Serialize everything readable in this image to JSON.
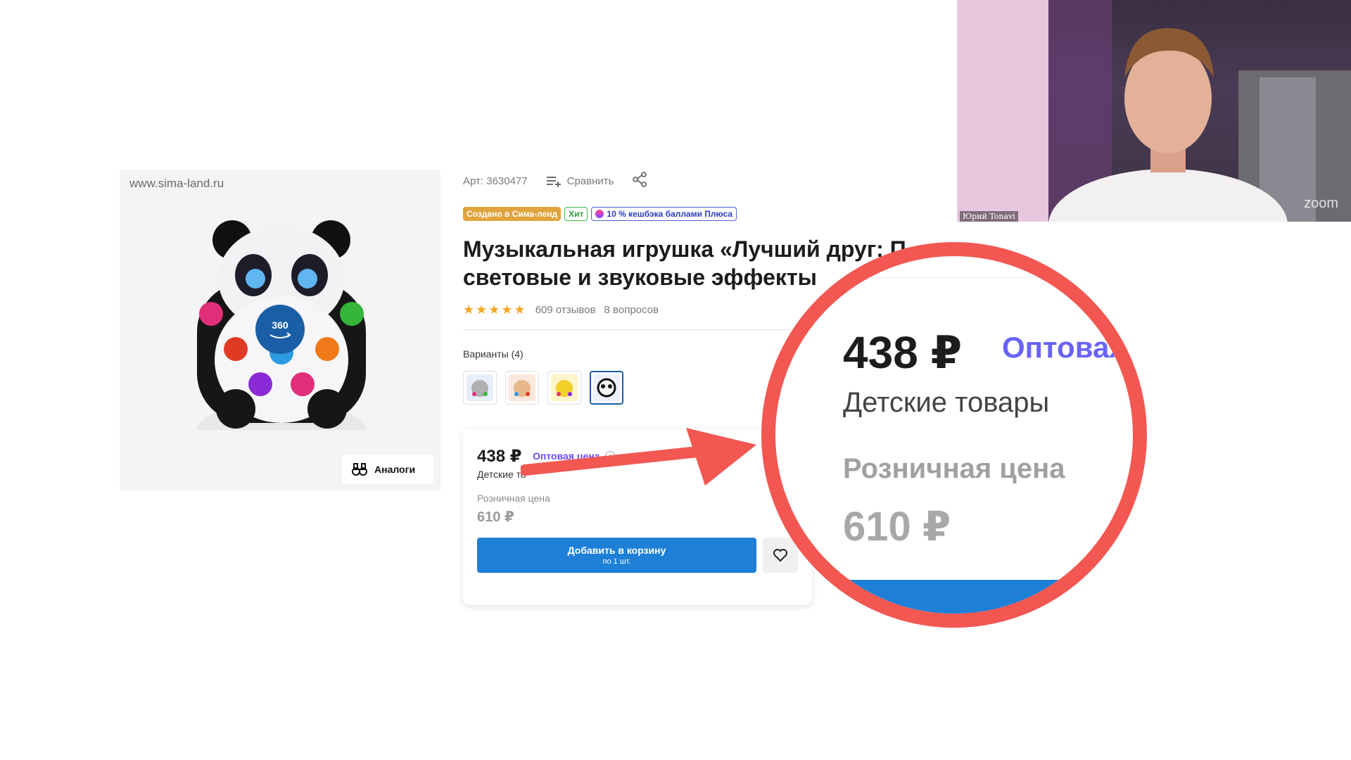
{
  "product": {
    "watermark": "www.sima-land.ru",
    "badge_360": "360",
    "analogs_label": "Аналоги",
    "article": "Арт: 3630477",
    "compare_label": "Сравнить",
    "badges": {
      "created": "Создано в Сима-ленд",
      "hit": "Хит",
      "cashback": "10 % кешбэка баллами Плюса"
    },
    "title": "Музыкальная игрушка «Лучший друг: П... световые и звуковые эффекты",
    "title_line1": "Музыкальная игрушка «Лучший друг: П",
    "title_line2": "световые и звуковые эффекты",
    "rating_stars": "★★★★★",
    "reviews": "609 отзывов",
    "questions": "8 вопросов",
    "variants_label": "Варианты (4)"
  },
  "price_card": {
    "price": "438 ₽",
    "wholesale_label": "Оптовая цена",
    "info_icon": "i",
    "category": "Детские то",
    "retail_label": "Розничная цена",
    "retail_price": "610 ₽",
    "add_to_cart": "Добавить в корзину",
    "add_to_cart_qty": "по 1 шт."
  },
  "zoom": {
    "price": "438 ₽",
    "wholesale_label": "Оптовая",
    "category": "Детские товары",
    "retail_label": "Розничная цена",
    "retail_price": "610 ₽"
  },
  "webcam": {
    "participant_name": "Юрий Tonavi",
    "app_logo": "zoom"
  },
  "colors": {
    "accent_blue": "#1e7fd6",
    "wholesale_purple": "#6a4bf0",
    "highlight_red": "#f25752"
  }
}
